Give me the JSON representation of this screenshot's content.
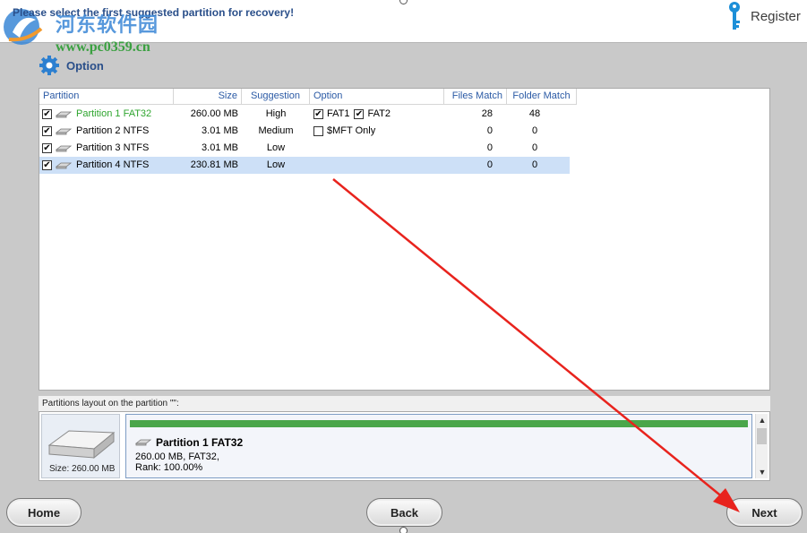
{
  "header": {
    "instruction": "Please select the first suggested partition for recovery!",
    "watermark_cn": "河东软件园",
    "watermark_url": "www.pc0359.cn",
    "register_label": "Register"
  },
  "option": {
    "label": "Option"
  },
  "table": {
    "columns": [
      "Partition",
      "Size",
      "Suggestion",
      "Option",
      "Files Match",
      "Folder Match"
    ],
    "rows": [
      {
        "checked": true,
        "name": "Partition 1 FAT32",
        "size": "260.00 MB",
        "suggestion": "High",
        "options": [
          {
            "checked": true,
            "label": "FAT1"
          },
          {
            "checked": true,
            "label": "FAT2"
          }
        ],
        "files": "28",
        "folders": "48",
        "highlight_color": "#2ea52e",
        "selected": false
      },
      {
        "checked": true,
        "name": "Partition 2 NTFS",
        "size": "3.01 MB",
        "suggestion": "Medium",
        "options": [
          {
            "checked": false,
            "label": "$MFT Only"
          }
        ],
        "files": "0",
        "folders": "0",
        "selected": false
      },
      {
        "checked": true,
        "name": "Partition 3 NTFS",
        "size": "3.01 MB",
        "suggestion": "Low",
        "options": [],
        "files": "0",
        "folders": "0",
        "selected": false
      },
      {
        "checked": true,
        "name": "Partition 4 NTFS",
        "size": "230.81 MB",
        "suggestion": "Low",
        "options": [],
        "files": "0",
        "folders": "0",
        "selected": true
      }
    ]
  },
  "layout": {
    "label": "Partitions layout on the partition \"\":",
    "disk_size": "Size: 260.00 MB",
    "partition_name": "Partition 1 FAT32",
    "partition_detail_1": "260.00 MB, FAT32,",
    "partition_detail_2": "Rank: 100.00%"
  },
  "buttons": {
    "home": "Home",
    "back": "Back",
    "next": "Next"
  },
  "colors": {
    "accent_blue": "#2b5aa5",
    "selected_row": "#cde0f7",
    "partition_bar": "#4aa64a",
    "annotation_arrow": "#e8231d"
  }
}
